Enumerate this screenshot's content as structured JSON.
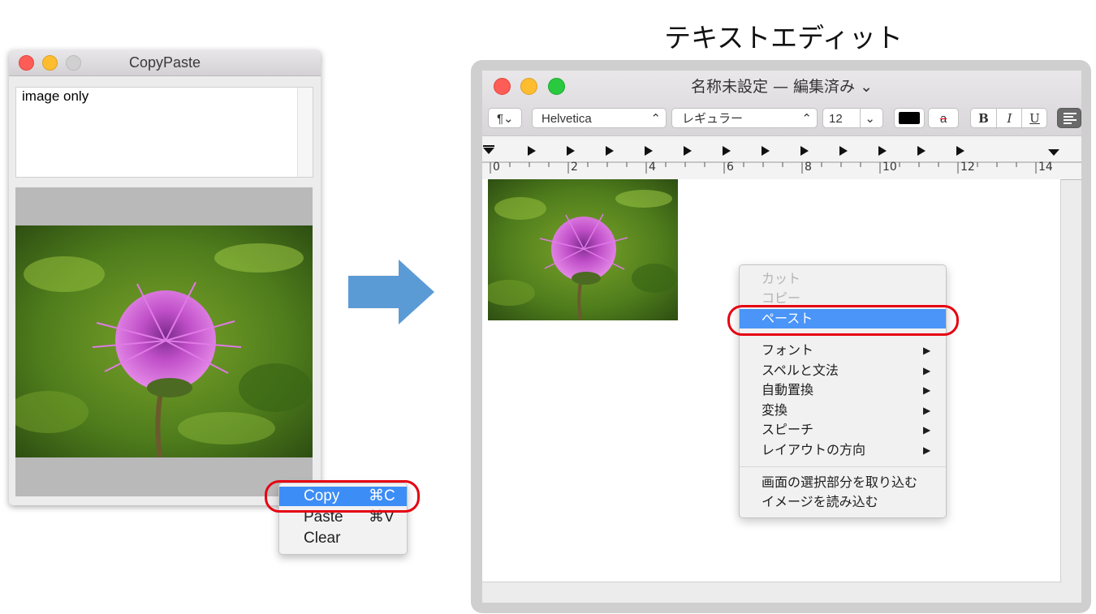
{
  "heading": "テキストエディット",
  "copypaste_window": {
    "title": "CopyPaste",
    "text_content": "image only",
    "context_menu": [
      {
        "label": "Copy",
        "shortcut": "⌘C",
        "selected": true
      },
      {
        "label": "Paste",
        "shortcut": "⌘V",
        "selected": false
      },
      {
        "label": "Clear",
        "shortcut": "",
        "selected": false
      }
    ]
  },
  "textedit_window": {
    "title": "名称未設定 — 編集済み ⌄",
    "toolbar": {
      "paragraph": "¶⌄",
      "font_family": "Helvetica",
      "font_style": "レギュラー",
      "font_size": "12",
      "bold": "B",
      "italic": "I",
      "underline": "U",
      "strike_sample": "a"
    },
    "ruler_labels": [
      "0",
      "2",
      "4",
      "6",
      "8",
      "10",
      "12",
      "14"
    ],
    "context_menu": {
      "items": [
        {
          "label": "カット",
          "disabled": true
        },
        {
          "label": "コピー",
          "disabled": true
        },
        {
          "label": "ペースト",
          "selected": true
        },
        {
          "label": "フォント",
          "submenu": true
        },
        {
          "label": "スペルと文法",
          "submenu": true
        },
        {
          "label": "自動置換",
          "submenu": true
        },
        {
          "label": "変換",
          "submenu": true
        },
        {
          "label": "スピーチ",
          "submenu": true
        },
        {
          "label": "レイアウトの方向",
          "submenu": true
        },
        {
          "label": "画面の選択部分を取り込む"
        },
        {
          "label": "イメージを読み込む"
        }
      ],
      "submenu_glyph": "▶"
    }
  },
  "colors": {
    "highlight_blue": "#3d8df6",
    "ring_red": "#e60012",
    "arrow_blue": "#5b9bd5",
    "traffic_close": "#fd5c57",
    "traffic_min": "#febd2f",
    "traffic_max": "#29c940"
  }
}
